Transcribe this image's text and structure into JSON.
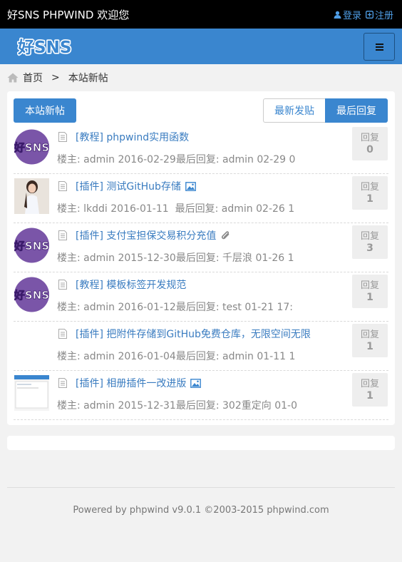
{
  "topbar": {
    "welcome": "好SNS PHPWIND 欢迎您",
    "login": "登录",
    "register": "注册"
  },
  "navbar": {
    "logo_text": "好SNS",
    "menu_icon": "hamburger-icon"
  },
  "breadcrumb": {
    "home": "首页",
    "separator": ">",
    "current": "本站新帖"
  },
  "toolbar": {
    "new_posts": "本站新帖",
    "sort_latest_post": "最新发贴",
    "sort_latest_reply": "最后回复",
    "active_sort": "最后回复"
  },
  "posts": [
    {
      "avatar": "logo-avatar",
      "title": "[教程] phpwind实用函数",
      "title_icon": "",
      "meta_author": "楼主: admin  2016-02-29",
      "meta_reply": "最后回复: admin  02-29 0",
      "reply_label": "回复",
      "reply_count": "0"
    },
    {
      "avatar": "photo-avatar",
      "title": "[插件] 测试GitHub存储",
      "title_icon": "image-icon",
      "meta_author": "楼主: lkddi  2016-01-11",
      "meta_reply": "最后回复: admin  02-26 1",
      "reply_label": "回复",
      "reply_count": "1"
    },
    {
      "avatar": "logo-avatar",
      "title": "[插件] 支付宝担保交易积分充值",
      "title_icon": "paperclip-icon",
      "meta_author": "楼主: admin  2015-12-30",
      "meta_reply": "最后回复: 千层浪  01-26 1",
      "reply_label": "回复",
      "reply_count": "3"
    },
    {
      "avatar": "logo-avatar",
      "title": "[教程] 模板标签开发规范",
      "title_icon": "",
      "meta_author": "楼主: admin  2016-01-12",
      "meta_reply": "最后回复: test  01-21 17:",
      "reply_label": "回复",
      "reply_count": "1"
    },
    {
      "avatar": "",
      "title": "[插件] 把附件存储到GitHub免费仓库，无限空间无限",
      "title_icon": "",
      "meta_author": "楼主: admin  2016-01-04",
      "meta_reply": "最后回复: admin  01-11 1",
      "reply_label": "回复",
      "reply_count": "1"
    },
    {
      "avatar": "screenshot-avatar",
      "title": "[插件] 相册插件一改进版",
      "title_icon": "image-icon",
      "meta_author": "楼主: admin  2015-12-31",
      "meta_reply": "最后回复: 302重定向  01-0",
      "reply_label": "回复",
      "reply_count": "1"
    }
  ],
  "footer": {
    "text": "Powered by phpwind v9.0.1 ©2003-2015 phpwind.com"
  },
  "colors": {
    "brand": "#3a86cf",
    "topbar": "#000000",
    "link": "#3a7cc0"
  }
}
